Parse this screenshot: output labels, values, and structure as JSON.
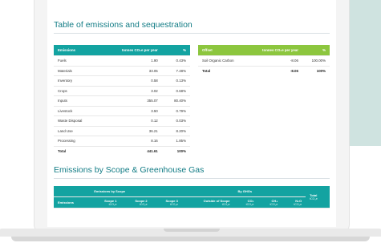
{
  "section1": {
    "title": "Table of emissions and sequestration"
  },
  "emissions_table": {
    "headers": [
      "Emissions",
      "tonnes CO₂e per year",
      "%"
    ],
    "rows": [
      [
        "Fuels",
        "1.90",
        "0.43%"
      ],
      [
        "Materials",
        "33.05",
        "7.48%"
      ],
      [
        "Inventory",
        "0.58",
        "0.13%"
      ],
      [
        "Crops",
        "3.02",
        "0.68%"
      ],
      [
        "Inputs",
        "355.07",
        "80.40%"
      ],
      [
        "Livestock",
        "3.50",
        "0.79%"
      ],
      [
        "Waste Disposal",
        "0.12",
        "0.03%"
      ],
      [
        "Land Use",
        "36.21",
        "8.20%"
      ],
      [
        "Processing",
        "8.16",
        "1.85%"
      ]
    ],
    "total": [
      "Total",
      "441.61",
      "100%"
    ]
  },
  "offset_table": {
    "headers": [
      "Offset",
      "tonnes CO₂e per year",
      "%"
    ],
    "rows": [
      [
        "Soil Organic Carbon",
        "-8.06",
        "100.00%"
      ]
    ],
    "total": [
      "Total",
      "-8.06",
      "100%"
    ]
  },
  "section2": {
    "title": "Emissions by Scope & Greenhouse Gas"
  },
  "scope_table": {
    "group_left": "Emissions by Scope",
    "group_right": "By GHGs",
    "row_header": "Emissions",
    "scope_cols": [
      {
        "label": "Scope 1",
        "unit": "tCO₂e"
      },
      {
        "label": "Scope 2",
        "unit": "tCO₂e"
      },
      {
        "label": "Scope 3",
        "unit": "tCO₂e"
      },
      {
        "label": "Outside of Scope",
        "unit": "tCO₂e"
      }
    ],
    "ghg_cols": [
      {
        "label": "CO₂",
        "unit": "tCO₂e"
      },
      {
        "label": "CH₄",
        "unit": "tCO₂e"
      },
      {
        "label": "N₂O",
        "unit": "tCO₂e"
      }
    ],
    "total_label": "Total",
    "total_unit": "tCO₂e"
  },
  "colors": {
    "teal": "#13a3a1",
    "green": "#8cc63e",
    "title": "#127c85"
  }
}
